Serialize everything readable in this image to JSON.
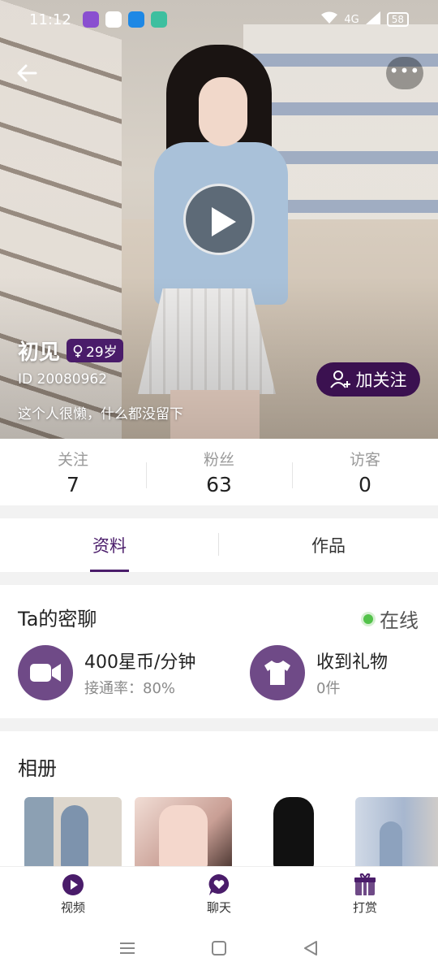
{
  "status_bar": {
    "time": "11:12",
    "battery": "58",
    "network": "4G"
  },
  "profile": {
    "nickname": "初见",
    "age": "29岁",
    "user_id": "ID 20080962",
    "bio": "这个人很懒，什么都没留下",
    "follow_label": "加关注"
  },
  "stats": [
    {
      "label": "关注",
      "value": "7"
    },
    {
      "label": "粉丝",
      "value": "63"
    },
    {
      "label": "访客",
      "value": "0"
    }
  ],
  "tabs": [
    {
      "label": "资料",
      "active": true
    },
    {
      "label": "作品",
      "active": false
    }
  ],
  "private_chat": {
    "title": "Ta的密聊",
    "status": "在线",
    "video": {
      "main": "400星币/分钟",
      "sub": "接通率：80%"
    },
    "gifts": {
      "main": "收到礼物",
      "sub": "0件"
    }
  },
  "album": {
    "title": "相册",
    "photo_count": 4
  },
  "bottom_nav": [
    {
      "label": "视频",
      "icon": "video-play-icon"
    },
    {
      "label": "聊天",
      "icon": "chat-heart-icon"
    },
    {
      "label": "打赏",
      "icon": "gift-icon"
    }
  ],
  "colors": {
    "accent": "#4a1c6a",
    "icon_bg": "#6f4a87",
    "online": "#53c24a"
  }
}
